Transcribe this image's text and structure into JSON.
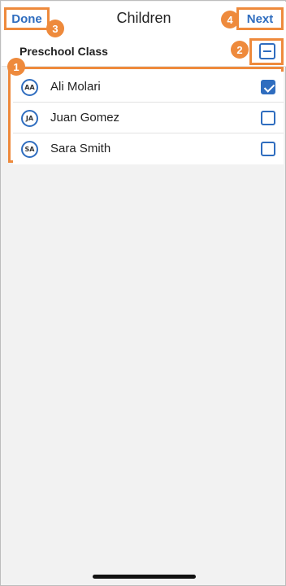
{
  "header": {
    "title": "Children",
    "done_label": "Done",
    "next_label": "Next"
  },
  "class_group": {
    "label": "Preschool Class",
    "selection_state": "partial"
  },
  "children": [
    {
      "initials": "AA",
      "name": "Ali Molari",
      "checked": true
    },
    {
      "initials": "JA",
      "name": "Juan Gomez",
      "checked": false
    },
    {
      "initials": "SA",
      "name": "Sara Smith",
      "checked": false
    }
  ],
  "callouts": [
    "1",
    "2",
    "3",
    "4"
  ],
  "colors": {
    "accent": "#2f6dbf",
    "callout": "#ee8a3c",
    "background": "#f2f2f2"
  }
}
